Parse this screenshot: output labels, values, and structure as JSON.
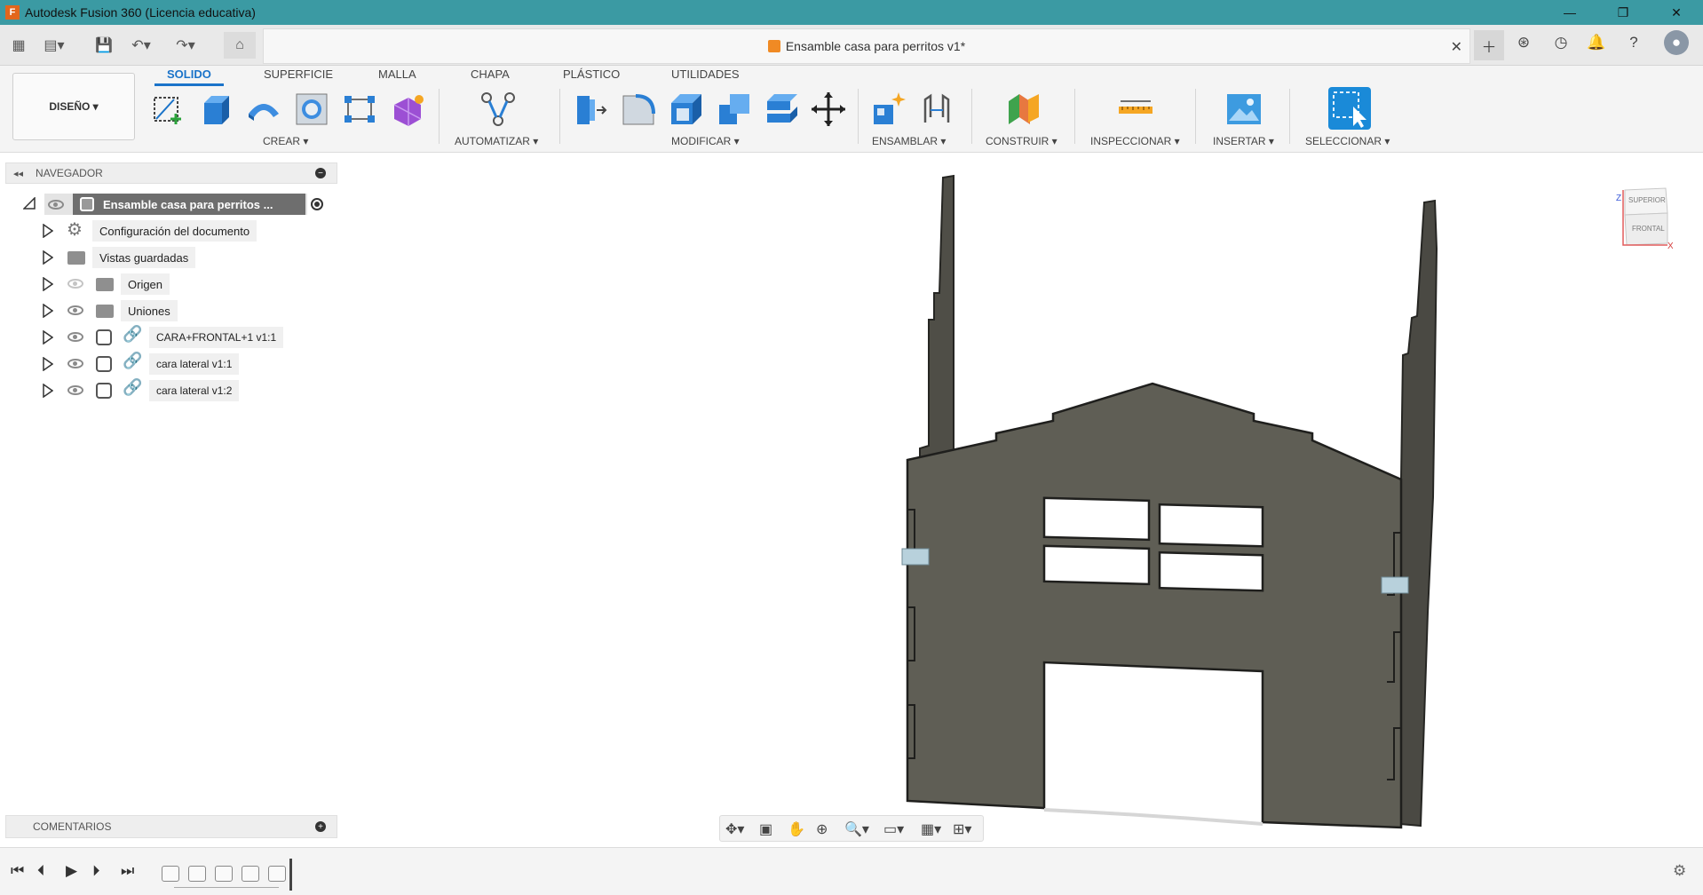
{
  "window": {
    "title": "Autodesk Fusion 360 (Licencia educativa)",
    "logo_letter": "F",
    "controls": [
      "—",
      "❐",
      "✕"
    ]
  },
  "document_tab": {
    "title": "Ensamble casa para perritos v1*",
    "close": "✕"
  },
  "quick_access": {
    "icons": [
      "grid-menu-icon",
      "file-icon",
      "save-icon",
      "undo-icon",
      "redo-icon",
      "home-icon"
    ],
    "right_icons": [
      "plus-icon",
      "extensions-icon",
      "job-status-icon",
      "notifications-icon",
      "help-icon",
      "user-avatar"
    ]
  },
  "toolbar": {
    "workspace": "DISEÑO ▾",
    "tabs": [
      "SOLIDO",
      "SUPERFICIE",
      "MALLA",
      "CHAPA",
      "PLÁSTICO",
      "UTILIDADES"
    ],
    "active_tab": "SOLIDO",
    "groups": [
      "CREAR ▾",
      "AUTOMATIZAR ▾",
      "MODIFICAR ▾",
      "ENSAMBLAR ▾",
      "CONSTRUIR ▾",
      "INSPECCIONAR ▾",
      "INSERTAR ▾",
      "SELECCIONAR ▾"
    ]
  },
  "navigator": {
    "header": "NAVEGADOR",
    "root": "Ensamble casa para perritos ...",
    "items": [
      {
        "label": "Configuración del documento",
        "type": "settings"
      },
      {
        "label": "Vistas guardadas",
        "type": "folder"
      },
      {
        "label": "Origen",
        "type": "folder-hidden"
      },
      {
        "label": "Uniones",
        "type": "folder"
      },
      {
        "label": "CARA+FRONTAL+1 v1:1",
        "type": "component"
      },
      {
        "label": "cara lateral v1:1",
        "type": "component"
      },
      {
        "label": "cara lateral v1:2",
        "type": "component"
      }
    ]
  },
  "comments": {
    "label": "COMENTARIOS"
  },
  "viewcube": {
    "top": "SUPERIOR",
    "front": "FRONTAL",
    "axis_x": "X",
    "axis_z": "Z"
  },
  "colors": {
    "titlebar": "#3b9aa3",
    "accent": "#1a73c9",
    "model_face": "#5f5e55",
    "model_edge": "#2b2b28"
  }
}
